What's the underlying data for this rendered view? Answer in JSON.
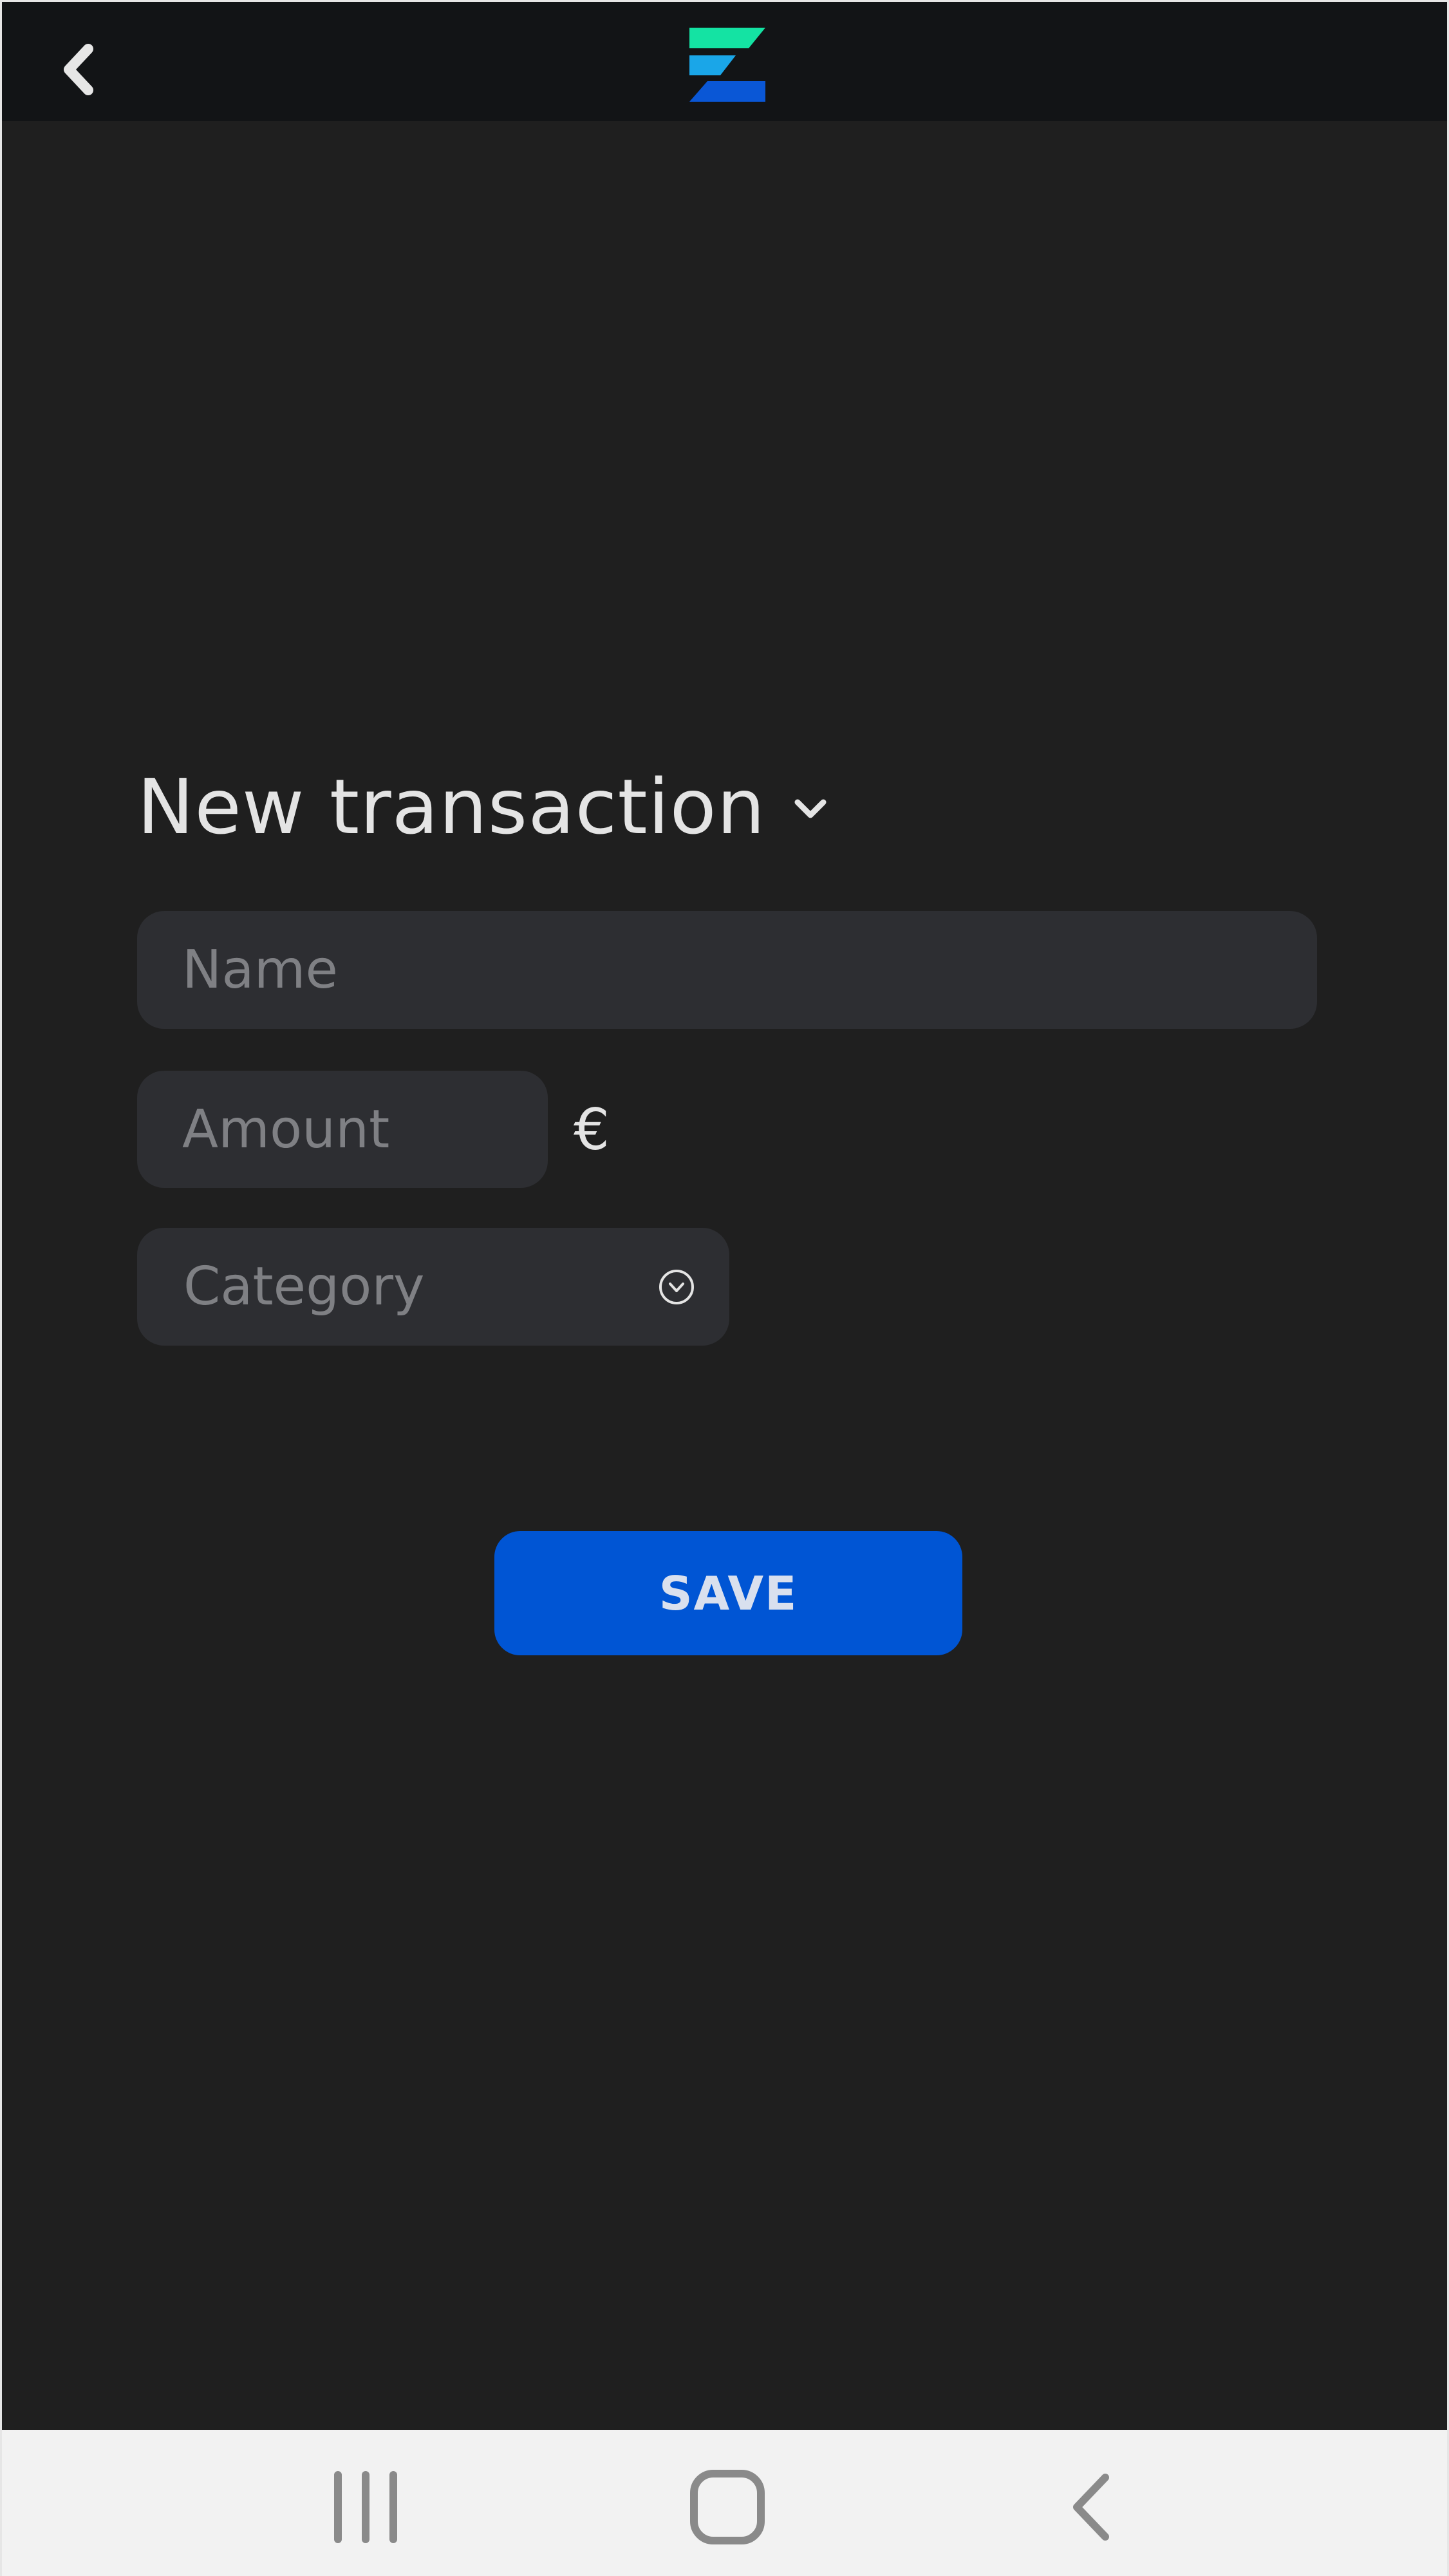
{
  "header": {
    "back_icon": "chevron-left-icon",
    "logo_icon": "app-logo-icon",
    "logo_colors": [
      "#14e3a3",
      "#1aa6e8",
      "#0a57d6"
    ]
  },
  "form": {
    "title": "New transaction",
    "title_icon": "chevron-down-icon",
    "name_placeholder": "Name",
    "amount_placeholder": "Amount",
    "currency_symbol": "€",
    "category_placeholder": "Category",
    "category_icon": "circle-chevron-down-icon",
    "save_label": "SAVE"
  },
  "navbar": {
    "items": [
      "recents-icon",
      "home-icon",
      "back-icon"
    ]
  },
  "colors": {
    "background": "#1f1f1f",
    "topbar": "#121416",
    "field": "#2d2e32",
    "accent": "#0055d4",
    "navbar": "#f2f2f2"
  }
}
